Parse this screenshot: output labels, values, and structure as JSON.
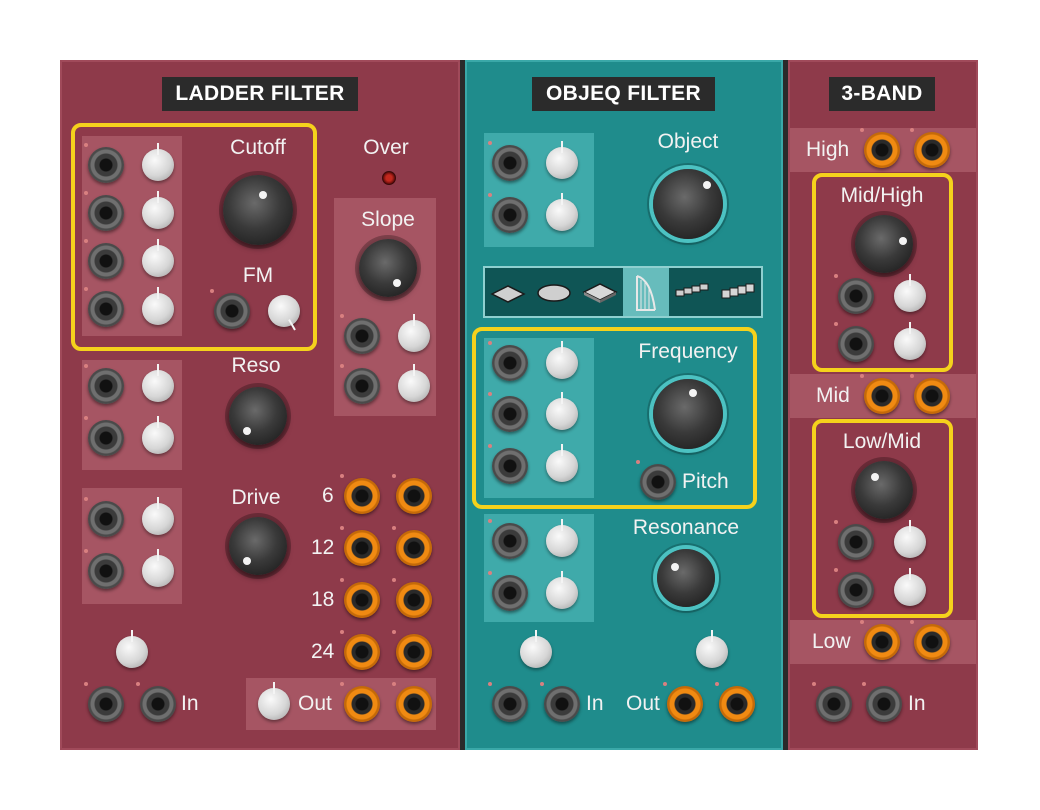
{
  "panels": {
    "ladder": {
      "title": "LADDER FILTER",
      "labels": {
        "cutoff": "Cutoff",
        "fm": "FM",
        "over": "Over",
        "slope": "Slope",
        "reso": "Reso",
        "drive": "Drive",
        "in": "In",
        "out": "Out",
        "slope_6": "6",
        "slope_12": "12",
        "slope_18": "18",
        "slope_24": "24"
      }
    },
    "objeq": {
      "title": "OBJEQ FILTER",
      "labels": {
        "object": "Object",
        "frequency": "Frequency",
        "pitch": "Pitch",
        "resonance": "Resonance",
        "in": "In",
        "out": "Out"
      },
      "object_shapes": [
        {
          "icon": "plate-square-icon"
        },
        {
          "icon": "plate-round-icon"
        },
        {
          "icon": "plate-thick-icon"
        },
        {
          "icon": "harp-icon",
          "selected": true
        },
        {
          "icon": "bars-icon"
        },
        {
          "icon": "bars-thick-icon"
        }
      ]
    },
    "band3": {
      "title": "3-BAND",
      "labels": {
        "high": "High",
        "mid_high": "Mid/High",
        "mid": "Mid",
        "low_mid": "Low/Mid",
        "low": "Low",
        "in": "In"
      }
    }
  },
  "colors": {
    "ladder_bg": "#8e3a4a",
    "objeq_bg": "#1f8c8c",
    "highlight": "#f5d21c",
    "output_jack": "#f08a12"
  }
}
